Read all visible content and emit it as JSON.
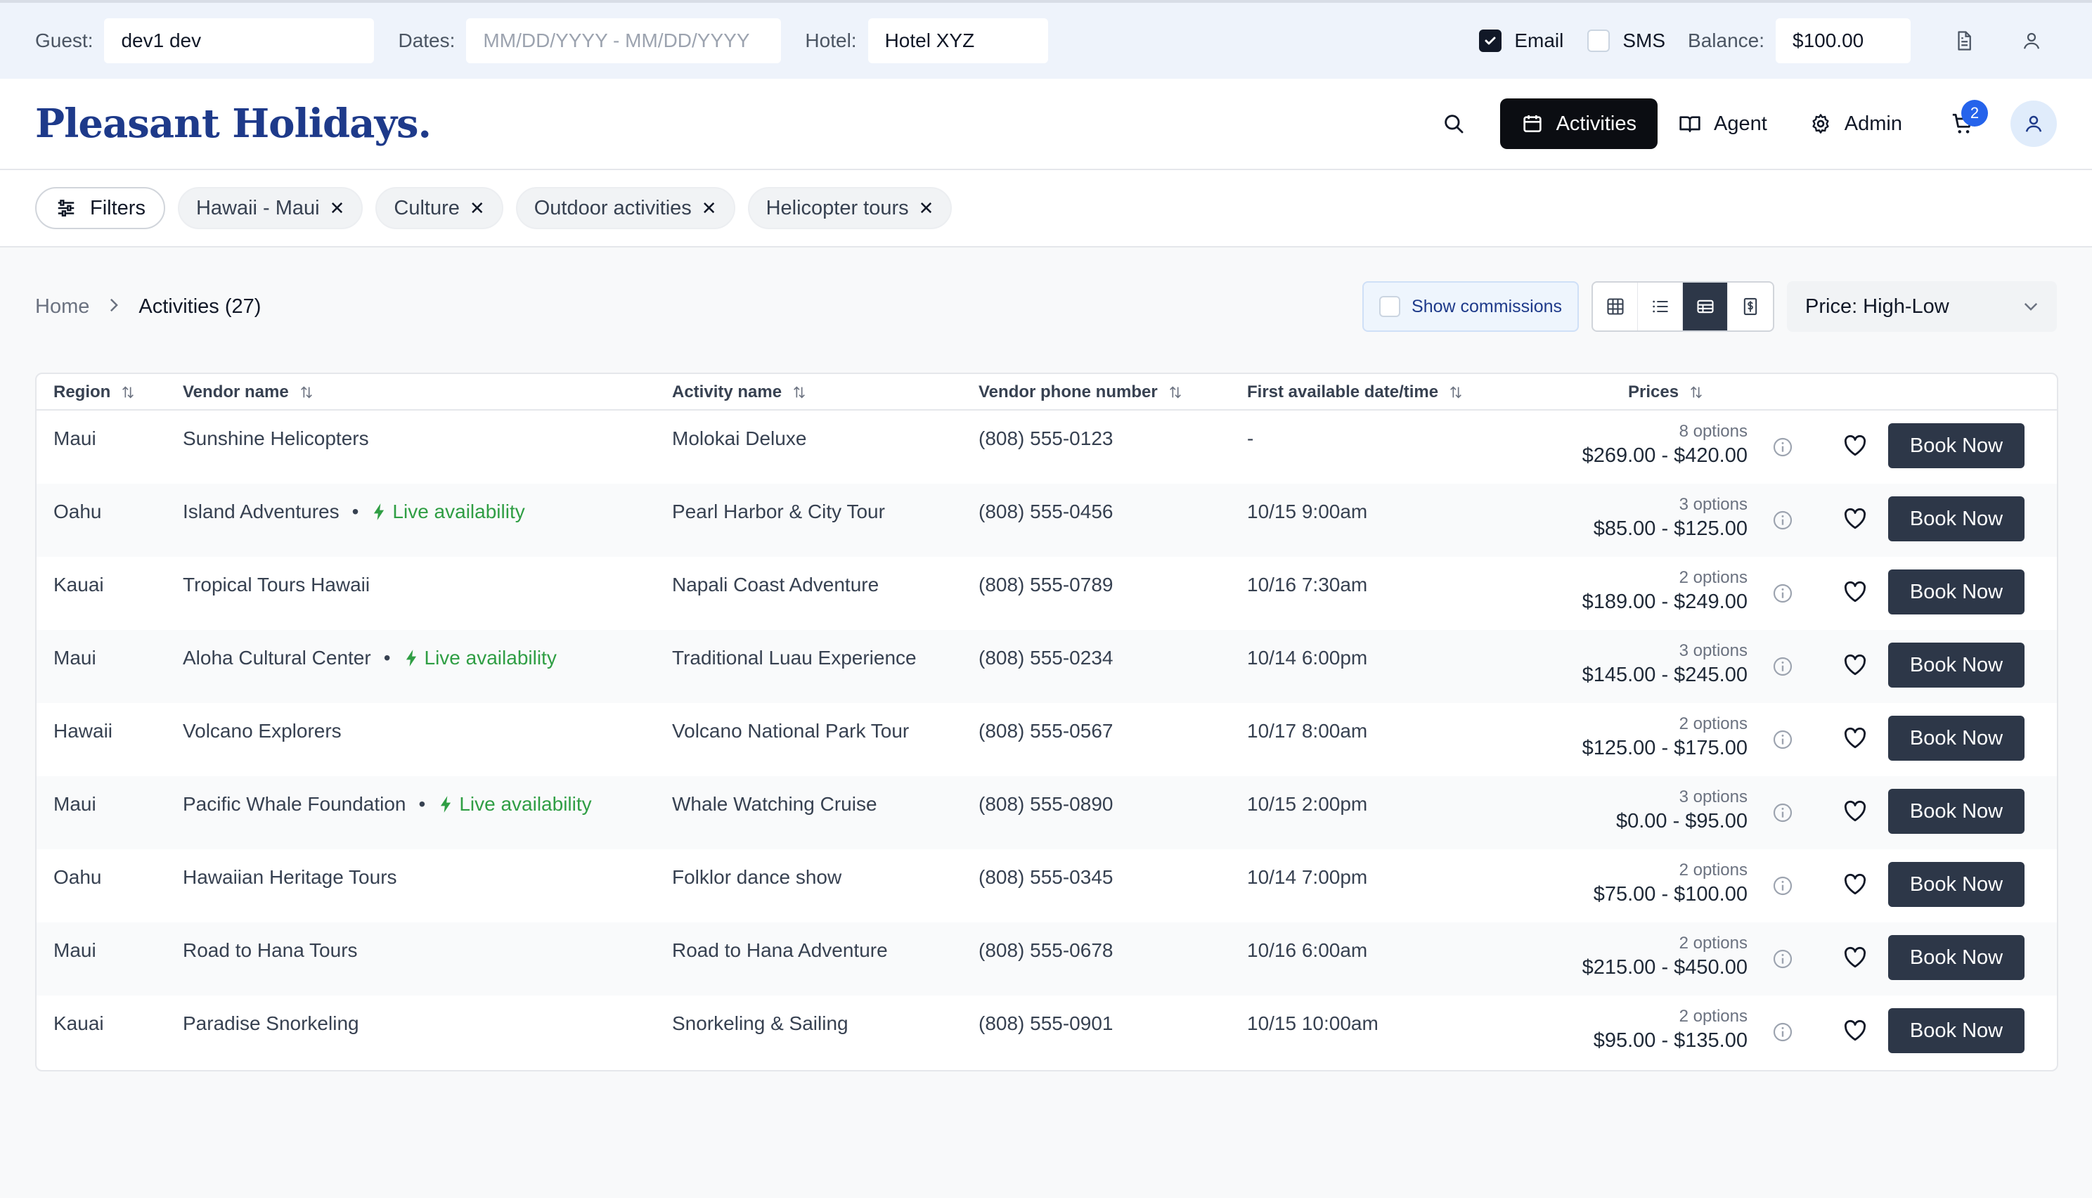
{
  "topbar": {
    "guest_label": "Guest:",
    "guest_value": "dev1 dev",
    "dates_label": "Dates:",
    "dates_placeholder": "MM/DD/YYYY - MM/DD/YYYY",
    "hotel_label": "Hotel:",
    "hotel_value": "Hotel XYZ",
    "email_label": "Email",
    "email_checked": true,
    "sms_label": "SMS",
    "sms_checked": false,
    "balance_label": "Balance:",
    "balance_value": "$100.00"
  },
  "header": {
    "logo_text": "Pleasant Holidays.",
    "nav": {
      "activities": "Activities",
      "agent": "Agent",
      "admin": "Admin"
    },
    "cart_count": "2"
  },
  "filters": {
    "button_label": "Filters",
    "chips": [
      "Hawaii - Maui",
      "Culture",
      "Outdoor activities",
      "Helicopter tours"
    ]
  },
  "breadcrumb": {
    "home": "Home",
    "current": "Activities (27)"
  },
  "toolbar": {
    "show_commissions": "Show commissions",
    "sort_value": "Price: High-Low"
  },
  "table": {
    "columns": {
      "region": "Region",
      "vendor": "Vendor name",
      "activity": "Activity name",
      "phone": "Vendor phone number",
      "first_available": "First available date/time",
      "prices": "Prices"
    },
    "live_label": "Live availability",
    "book_label": "Book Now",
    "rows": [
      {
        "region": "Maui",
        "vendor": "Sunshine Helicopters",
        "live": false,
        "activity": "Molokai Deluxe",
        "phone": "(808) 555-0123",
        "first": "-",
        "options": "8 options",
        "range": "$269.00 - $420.00"
      },
      {
        "region": "Oahu",
        "vendor": "Island Adventures",
        "live": true,
        "activity": "Pearl Harbor & City Tour",
        "phone": "(808) 555-0456",
        "first": "10/15 9:00am",
        "options": "3 options",
        "range": "$85.00 - $125.00"
      },
      {
        "region": "Kauai",
        "vendor": "Tropical Tours Hawaii",
        "live": false,
        "activity": "Napali Coast Adventure",
        "phone": "(808) 555-0789",
        "first": "10/16 7:30am",
        "options": "2 options",
        "range": "$189.00 - $249.00"
      },
      {
        "region": "Maui",
        "vendor": "Aloha Cultural Center",
        "live": true,
        "activity": "Traditional Luau Experience",
        "phone": "(808) 555-0234",
        "first": "10/14 6:00pm",
        "options": "3 options",
        "range": "$145.00 - $245.00"
      },
      {
        "region": "Hawaii",
        "vendor": "Volcano Explorers",
        "live": false,
        "activity": "Volcano National Park Tour",
        "phone": "(808) 555-0567",
        "first": "10/17 8:00am",
        "options": "2 options",
        "range": "$125.00 - $175.00"
      },
      {
        "region": "Maui",
        "vendor": "Pacific Whale Foundation",
        "live": true,
        "activity": "Whale Watching Cruise",
        "phone": "(808) 555-0890",
        "first": "10/15 2:00pm",
        "options": "3 options",
        "range": "$0.00 - $95.00"
      },
      {
        "region": "Oahu",
        "vendor": "Hawaiian Heritage Tours",
        "live": false,
        "activity": "Folklor dance show",
        "phone": "(808) 555-0345",
        "first": "10/14 7:00pm",
        "options": "2 options",
        "range": "$75.00 - $100.00"
      },
      {
        "region": "Maui",
        "vendor": "Road to Hana Tours",
        "live": false,
        "activity": "Road to Hana Adventure",
        "phone": "(808) 555-0678",
        "first": "10/16 6:00am",
        "options": "2 options",
        "range": "$215.00 - $450.00"
      },
      {
        "region": "Kauai",
        "vendor": "Paradise Snorkeling",
        "live": false,
        "activity": "Snorkeling & Sailing",
        "phone": "(808) 555-0901",
        "first": "10/15 10:00am",
        "options": "2 options",
        "range": "$95.00 - $135.00"
      }
    ]
  },
  "colors": {
    "accent_dark": "#2d3748",
    "live_green": "#2f9e44",
    "logo_blue": "#1e3a8a",
    "badge_blue": "#2563eb"
  }
}
